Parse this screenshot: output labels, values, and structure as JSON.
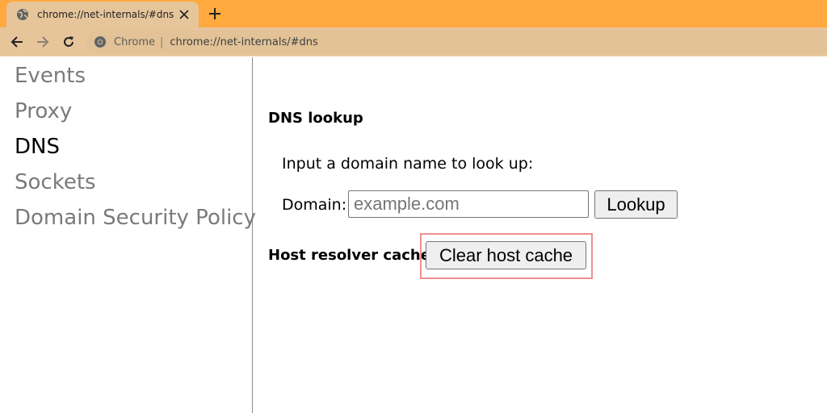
{
  "browser": {
    "tab": {
      "title": "chrome://net-internals/#dns"
    },
    "omnibox": {
      "site_label": "Chrome",
      "separator": "|",
      "url": "chrome://net-internals/#dns"
    }
  },
  "sidebar": {
    "items": [
      {
        "label": "Events",
        "active": false
      },
      {
        "label": "Proxy",
        "active": false
      },
      {
        "label": "DNS",
        "active": true
      },
      {
        "label": "Sockets",
        "active": false
      },
      {
        "label": "Domain Security Policy",
        "active": false
      }
    ]
  },
  "dns": {
    "heading": "DNS lookup",
    "prompt": "Input a domain name to look up:",
    "domain_label": "Domain:",
    "domain_placeholder": "example.com",
    "domain_value": "",
    "lookup_label": "Lookup",
    "cache_heading": "Host resolver cache",
    "clear_label": "Clear host cache"
  },
  "colors": {
    "titlebar": "#ffa93f",
    "toolbar": "#e7c59a",
    "highlight": "#ee8f8f",
    "active_nav": "#000000",
    "inactive_nav": "#7a7a7a"
  }
}
